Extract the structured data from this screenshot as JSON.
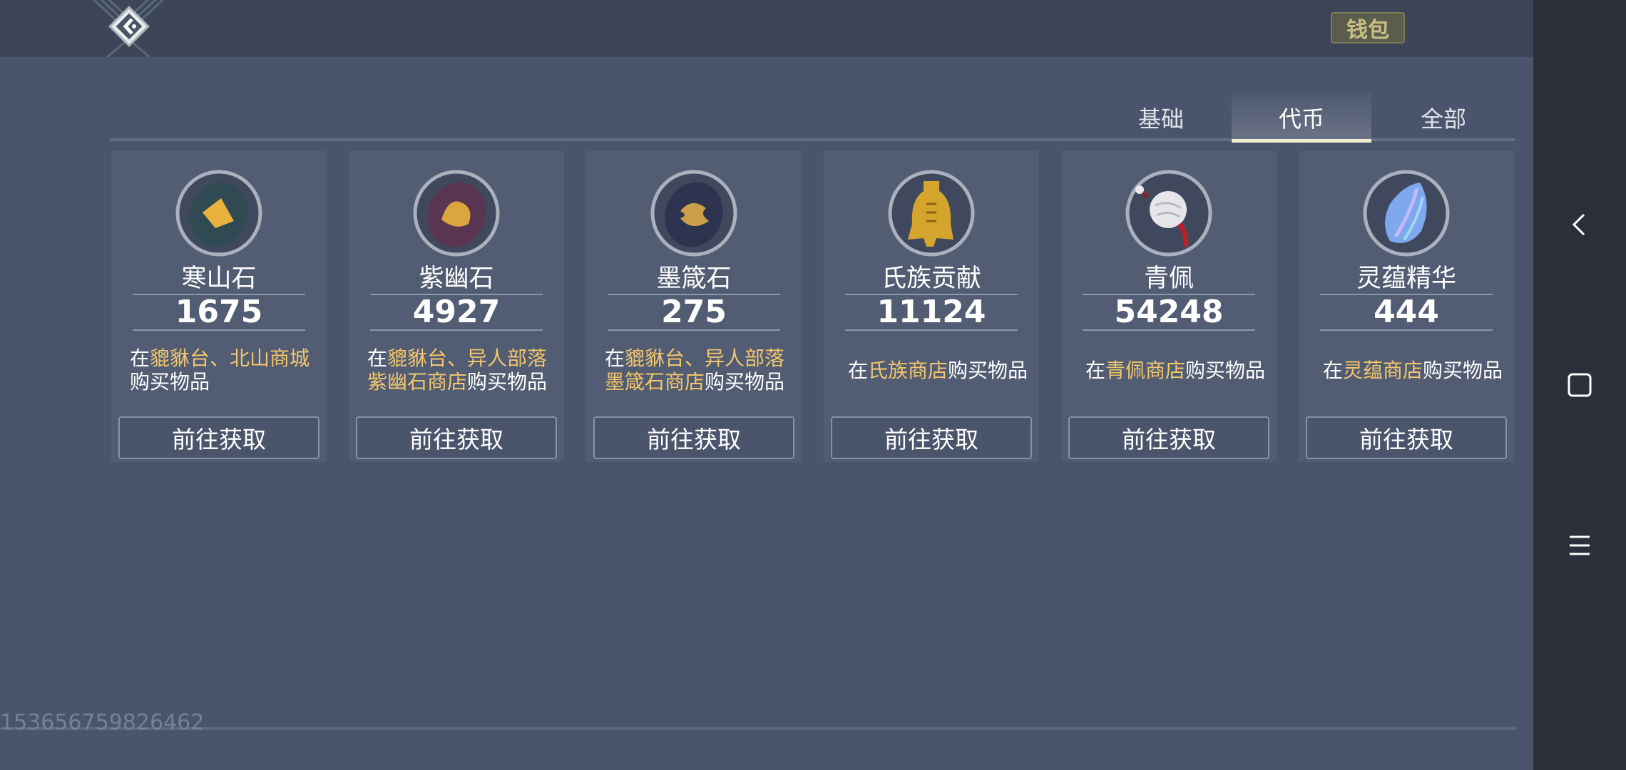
{
  "header": {
    "wallet_label": "钱包",
    "back_icon": "back-arrow-icon"
  },
  "tabs": [
    {
      "label": "基础",
      "active": false
    },
    {
      "label": "代币",
      "active": true
    },
    {
      "label": "全部",
      "active": false
    }
  ],
  "items": [
    {
      "name": "寒山石",
      "count": "1675",
      "icon": "hanshan-stone-icon",
      "desc_pre": "在",
      "desc_hl1": "貔貅台、北山商城",
      "desc_line2_hl": "",
      "desc_post": "购买物品",
      "button": "前往获取"
    },
    {
      "name": "紫幽石",
      "count": "4927",
      "icon": "ziyou-stone-icon",
      "desc_pre": "在",
      "desc_hl1": "貔貅台、异人部落",
      "desc_line2_hl": "紫幽石商店",
      "desc_post": "购买物品",
      "button": "前往获取"
    },
    {
      "name": "墨箴石",
      "count": "275",
      "icon": "mozhen-stone-icon",
      "desc_pre": "在",
      "desc_hl1": "貔貅台、异人部落",
      "desc_line2_hl": "墨箴石商店",
      "desc_post": "购买物品",
      "button": "前往获取"
    },
    {
      "name": "氏族贡献",
      "count": "11124",
      "icon": "clan-contribution-icon",
      "desc_pre": "在",
      "desc_hl1": "氏族商店",
      "desc_line2_hl": "",
      "desc_post": "购买物品",
      "button": "前往获取"
    },
    {
      "name": "青佩",
      "count": "54248",
      "icon": "jade-pendant-icon",
      "desc_pre": "在",
      "desc_hl1": "青佩商店",
      "desc_line2_hl": "",
      "desc_post": "购买物品",
      "button": "前往获取"
    },
    {
      "name": "灵蕴精华",
      "count": "444",
      "icon": "spirit-essence-icon",
      "desc_pre": "在",
      "desc_hl1": "灵蕴商店",
      "desc_line2_hl": "",
      "desc_post": "购买物品",
      "button": "前往获取"
    }
  ],
  "footer": {
    "uid": "153656759826462"
  },
  "system_nav": {
    "back": "nav-back-icon",
    "home": "nav-home-icon",
    "menu": "nav-menu-icon"
  },
  "colors": {
    "background": "#4a546c",
    "highlight": "#f2c66c",
    "tab_underline": "#f0eed2"
  }
}
